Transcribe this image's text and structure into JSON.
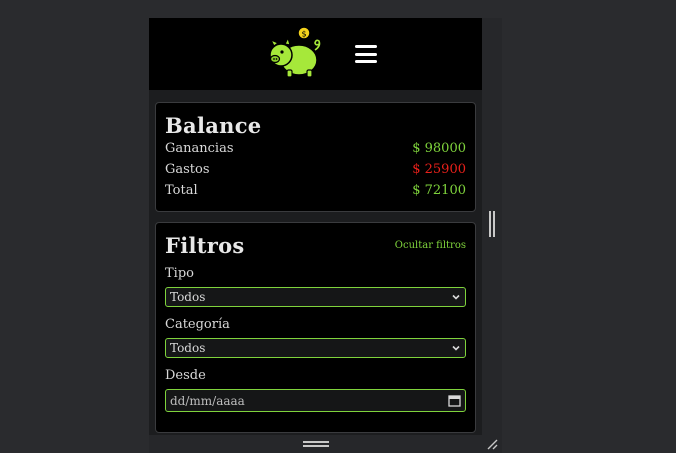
{
  "balance": {
    "title": "Balance",
    "rows": [
      {
        "label": "Ganancias",
        "value": "$ 98000"
      },
      {
        "label": "Gastos",
        "value": "$ 25900"
      },
      {
        "label": "Total",
        "value": "$ 72100"
      }
    ]
  },
  "filters": {
    "title": "Filtros",
    "hide_label": "Ocultar filtros",
    "tipo_label": "Tipo",
    "tipo_value": "Todos",
    "categoria_label": "Categoría",
    "categoria_value": "Todos",
    "desde_label": "Desde",
    "desde_placeholder": "dd/mm/aaaa"
  },
  "colors": {
    "accent": "#7fd33c",
    "negative": "#e8201a"
  },
  "icons": [
    "piggy-bank-logo",
    "hamburger-menu-icon",
    "chevron-down-icon",
    "calendar-icon",
    "resize-grip-icon"
  ]
}
